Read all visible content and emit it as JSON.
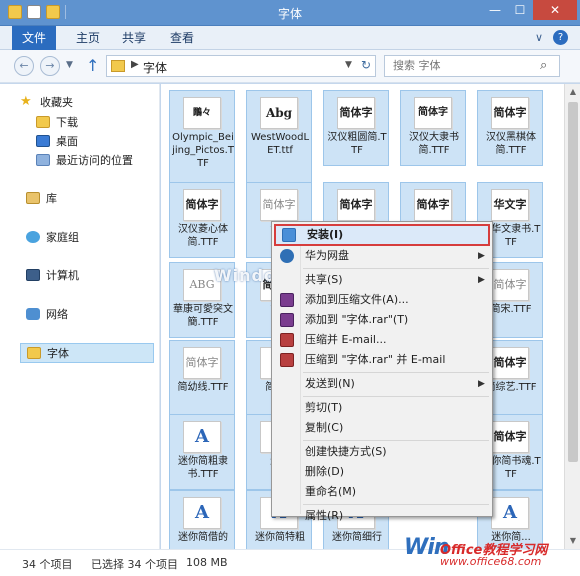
{
  "window": {
    "title": "字体",
    "min_glyph": "—",
    "max_glyph": "☐",
    "close_glyph": "✕"
  },
  "ribbon": {
    "tabs": [
      "文件",
      "主页",
      "共享",
      "查看"
    ],
    "help_glyph": "?",
    "expand_glyph": "∨"
  },
  "address": {
    "crumb": "字体",
    "search_placeholder": "搜索 字体"
  },
  "nav": {
    "items": [
      {
        "label": "收藏夹",
        "icon": "star-icon"
      },
      {
        "label": "下载",
        "icon": "download-folder-icon"
      },
      {
        "label": "桌面",
        "icon": "desktop-icon"
      },
      {
        "label": "最近访问的位置",
        "icon": "recent-places-icon"
      },
      {
        "label": "库",
        "icon": "library-icon"
      },
      {
        "label": "家庭组",
        "icon": "homegroup-icon"
      },
      {
        "label": "计算机",
        "icon": "computer-icon"
      },
      {
        "label": "网络",
        "icon": "network-icon"
      },
      {
        "label": "字体",
        "icon": "folder-icon"
      }
    ]
  },
  "files": [
    {
      "name": "Olympic_Beijing_Pictos.TTF",
      "preview": "鷳々"
    },
    {
      "name": "WestWoodLET.ttf",
      "preview": "Abg"
    },
    {
      "name": "汉仪粗圆简.TTF",
      "preview": "简体字"
    },
    {
      "name": "汉仪大隶书简.TTF",
      "preview": "简体字"
    },
    {
      "name": "汉仪黑棋体简.TTF",
      "preview": "简体字"
    },
    {
      "name": "汉仪菱心体简.TTF",
      "preview": "简体字"
    },
    {
      "name": "汉...",
      "preview": "简体字"
    },
    {
      "name": "",
      "preview": "简体字"
    },
    {
      "name": "",
      "preview": "简体字"
    },
    {
      "name": "...华文隶书.TTF",
      "preview": "华文字"
    },
    {
      "name": "華康可愛突文簡.TTF",
      "preview": "ABG"
    },
    {
      "name": "简...",
      "preview": "简体字"
    },
    {
      "name": "简宋.TTF",
      "preview": "简体字"
    },
    {
      "name": "简幼线.TTF",
      "preview": "简体字"
    },
    {
      "name": "简中...",
      "preview": "简"
    },
    {
      "name": "简综艺.TTF",
      "preview": "简体字"
    },
    {
      "name": "迷你简粗隶书.TTF",
      "preview": "A"
    },
    {
      "name": "迷...",
      "preview": "简"
    },
    {
      "name": "迷你简书魂.TTF",
      "preview": "简体字"
    },
    {
      "name": "迷你简借的",
      "preview": "A"
    },
    {
      "name": "迷你简特粗",
      "preview": "A"
    },
    {
      "name": "迷你简细行",
      "preview": "A"
    },
    {
      "name": "迷你简...",
      "preview": "A"
    }
  ],
  "context_menu": {
    "items": [
      {
        "label": "安装(I)",
        "icon": "shield-install-icon"
      },
      {
        "label": "华为网盘",
        "icon": "huawei-cloud-icon"
      },
      {
        "label": "共享(S)",
        "icon": ""
      },
      {
        "label": "添加到压缩文件(A)...",
        "icon": "winrar-icon"
      },
      {
        "label": "添加到 \"字体.rar\"(T)",
        "icon": "winrar-icon"
      },
      {
        "label": "压缩并 E-mail...",
        "icon": "winrar-icon"
      },
      {
        "label": "压缩到 \"字体.rar\" 并 E-mail",
        "icon": "winrar-icon"
      },
      {
        "label": "发送到(N)",
        "icon": ""
      },
      {
        "label": "剪切(T)",
        "icon": ""
      },
      {
        "label": "复制(C)",
        "icon": ""
      },
      {
        "label": "创建快捷方式(S)",
        "icon": ""
      },
      {
        "label": "删除(D)",
        "icon": ""
      },
      {
        "label": "重命名(M)",
        "icon": ""
      },
      {
        "label": "属性(R)",
        "icon": ""
      }
    ]
  },
  "status": {
    "count": "34 个项目",
    "selected": "已选择 34 个项目",
    "size": "108 MB"
  },
  "watermark": {
    "center": "Windows教程",
    "brand": "Win",
    "site": "Office教程学习网",
    "url": "www.office68.com"
  }
}
